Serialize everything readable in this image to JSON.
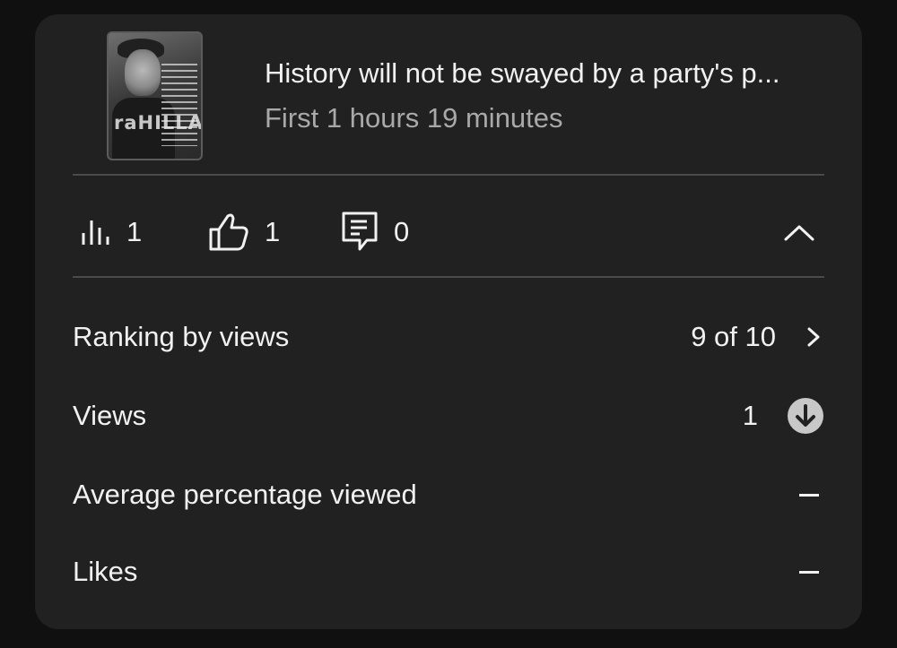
{
  "video": {
    "title": "History will not be swayed by a party's p...",
    "subtitle": "First 1 hours 19 minutes",
    "thumbnail_word": "raHILLA"
  },
  "stats": {
    "views": {
      "icon": "bar-chart-icon",
      "count": "1"
    },
    "likes": {
      "icon": "thumbs-up-icon",
      "count": "1"
    },
    "comments": {
      "icon": "comment-icon",
      "count": "0"
    },
    "toggle_icon": "chevron-up-icon"
  },
  "metrics": [
    {
      "label": "Ranking by views",
      "value": "9 of 10",
      "icon": "chevron-right-icon"
    },
    {
      "label": "Views",
      "value": "1",
      "icon": "arrow-down-circle-icon"
    },
    {
      "label": "Average percentage viewed",
      "value": "—"
    },
    {
      "label": "Likes",
      "value": "—"
    }
  ],
  "colors": {
    "background": "#101010",
    "card": "#212121",
    "text": "#f1f1f1",
    "secondary_text": "#a9a9a9",
    "divider": "#4a4a4a",
    "down_badge": "#c8c8c8"
  }
}
